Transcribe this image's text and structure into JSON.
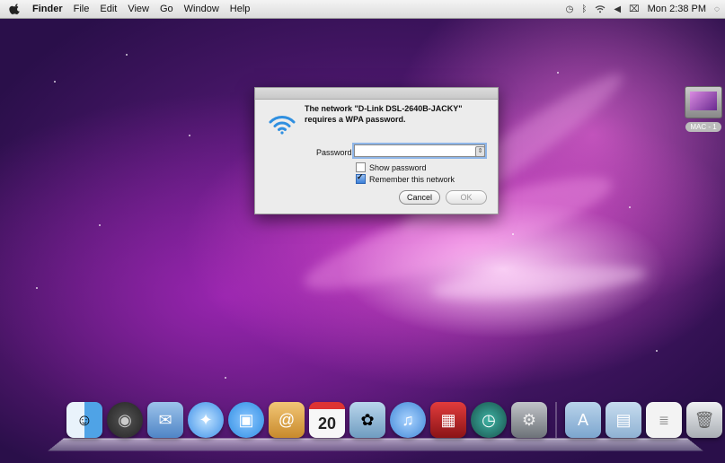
{
  "menubar": {
    "app": "Finder",
    "items": [
      "File",
      "Edit",
      "View",
      "Go",
      "Window",
      "Help"
    ],
    "clock": "Mon 2:38 PM"
  },
  "desktop": {
    "drive_label": "MAC - 1"
  },
  "dialog": {
    "message": "The network \"D-Link DSL-2640B-JACKY\" requires a WPA password.",
    "password_label": "Password:",
    "password_value": "",
    "show_password_label": "Show password",
    "show_password_checked": false,
    "remember_label": "Remember this network",
    "remember_checked": true,
    "cancel_label": "Cancel",
    "ok_label": "OK"
  },
  "dock": {
    "items": [
      {
        "name": "finder-icon",
        "color": "#4fa3e6"
      },
      {
        "name": "dashboard-icon",
        "color": "#3a3a3a"
      },
      {
        "name": "mail-icon",
        "color": "#6f9fd8"
      },
      {
        "name": "safari-icon",
        "color": "#3b8fe8"
      },
      {
        "name": "ichat-icon",
        "color": "#2e8de3"
      },
      {
        "name": "address-book-icon",
        "color": "#d9a54a"
      },
      {
        "name": "ical-icon",
        "color": "#f2f2f2",
        "text": "20"
      },
      {
        "name": "iphoto-icon",
        "color": "#8cb7d8"
      },
      {
        "name": "itunes-icon",
        "color": "#3f86d6"
      },
      {
        "name": "photo-booth-icon",
        "color": "#c0262a"
      },
      {
        "name": "time-machine-icon",
        "color": "#1e6c63"
      },
      {
        "name": "system-preferences-icon",
        "color": "#8a8f96"
      },
      {
        "name": "applications-folder-icon",
        "color": "#8fb3d6"
      },
      {
        "name": "documents-folder-icon",
        "color": "#9fc0df"
      },
      {
        "name": "document-icon",
        "color": "#f3f3f3"
      },
      {
        "name": "trash-icon",
        "color": "#cfd3d8"
      }
    ]
  }
}
